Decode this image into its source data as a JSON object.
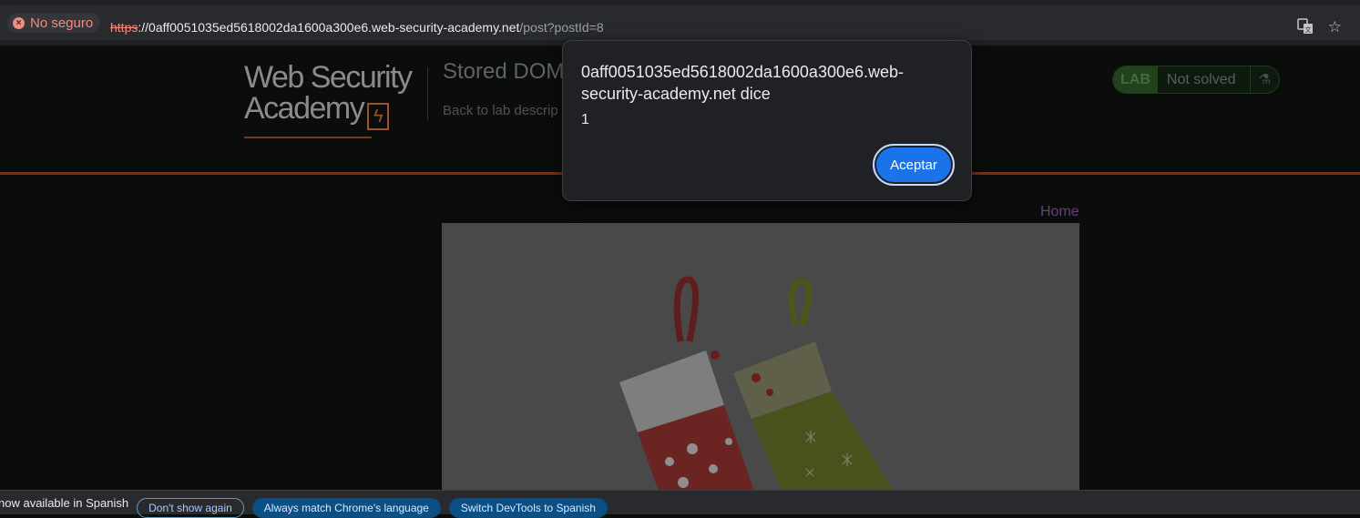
{
  "browser": {
    "security_label": "No seguro",
    "url_scheme": "https",
    "url_host": "://0aff0051035ed5618002da1600a300e6.web-security-academy.net",
    "url_path": "/post?postId=8",
    "translate_icon": "translate-icon",
    "bookmark_icon": "star-icon"
  },
  "site": {
    "logo_line1": "Web Security",
    "logo_line2": "Academy",
    "lab_title": "Stored DOM",
    "back_link": "Back to lab descrip",
    "lab_badge": "LAB",
    "lab_status": "Not solved",
    "lab_icon": "flask-icon",
    "home_link": "Home"
  },
  "dialog": {
    "title": "0aff0051035ed5618002da1600a300e6.web-security-academy.net dice",
    "message": "1",
    "ok_label": "Aceptar"
  },
  "devtools_bar": {
    "message": "now available in Spanish",
    "dont_show": "Don't show again",
    "always_match": "Always match Chrome's language",
    "switch": "Switch DevTools to Spanish"
  },
  "colors": {
    "accent_blue": "#1a73e8",
    "lab_green": "#22421d",
    "header_rule": "#8a2a0c"
  }
}
